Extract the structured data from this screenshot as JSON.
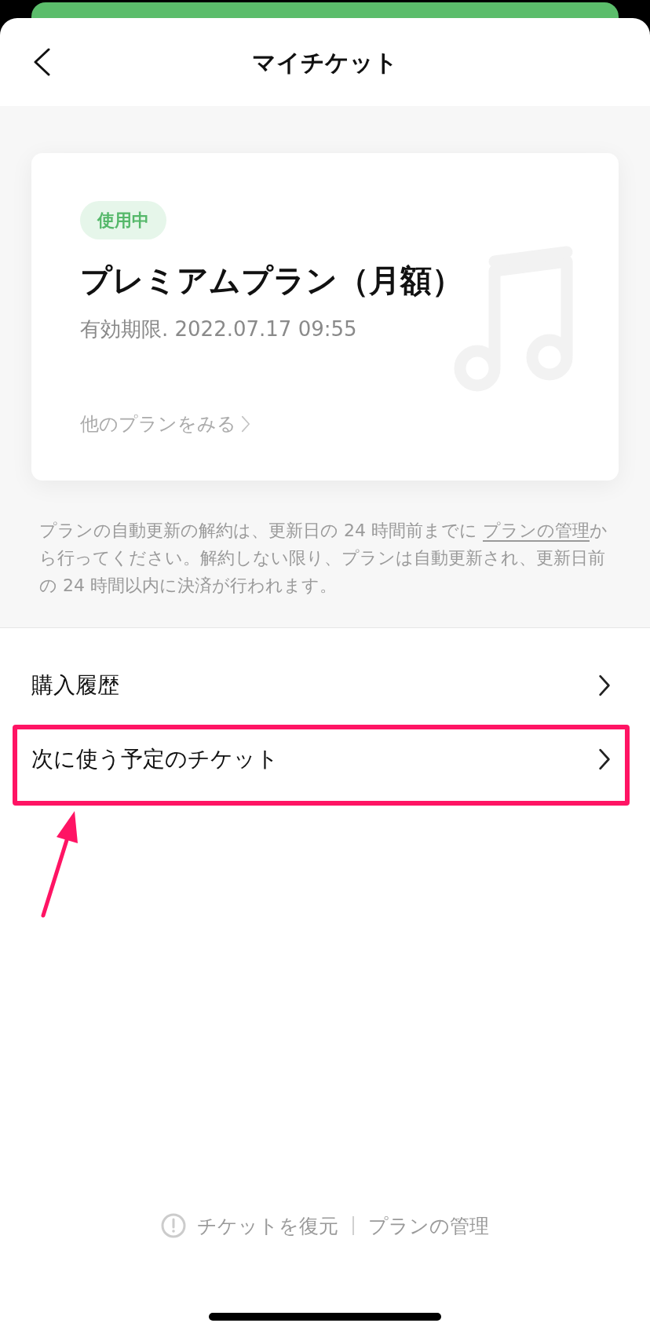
{
  "header": {
    "title": "マイチケット"
  },
  "plan_card": {
    "status_badge": "使用中",
    "plan_name": "プレミアムプラン（月額）",
    "expiry": "有効期限. 2022.07.17 09:55",
    "other_plans_link": "他のプランをみる"
  },
  "notice": {
    "before_link": "プランの自動更新の解約は、更新日の 24 時間前までに ",
    "link": "プランの管理",
    "after_link": "から行ってください。解約しない限り、プランは自動更新され、更新日前の 24 時間以内に決済が行われます。"
  },
  "menu": [
    {
      "label": "購入履歴",
      "highlighted": false
    },
    {
      "label": "次に使う予定のチケット",
      "highlighted": true
    }
  ],
  "footer": {
    "restore": "チケットを復元",
    "manage": "プランの管理"
  }
}
